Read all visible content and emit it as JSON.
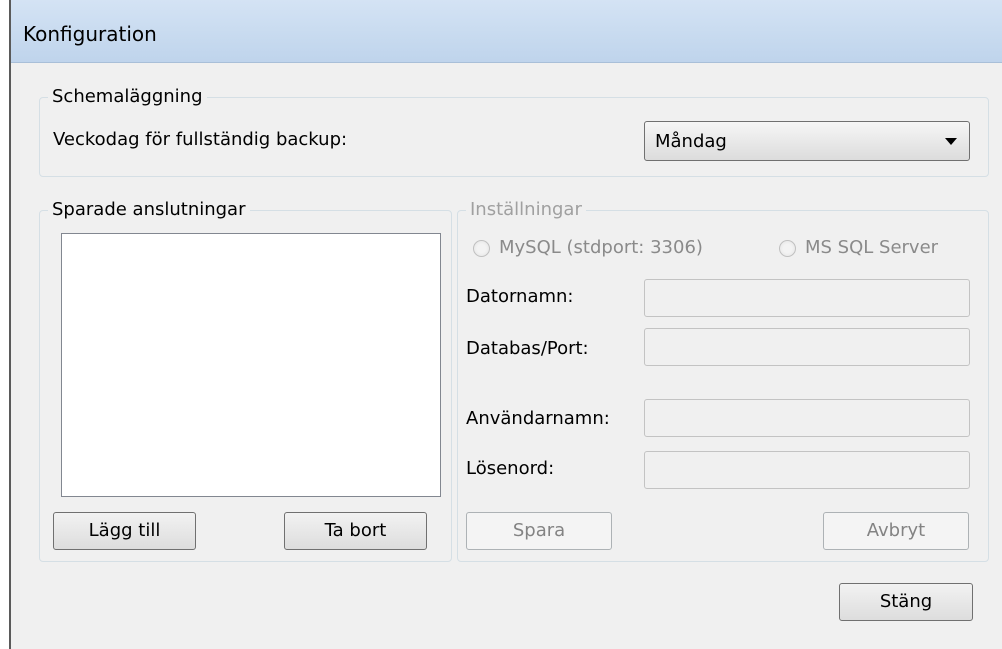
{
  "window": {
    "title": "Konfiguration"
  },
  "schedule": {
    "legend": "Schemaläggning",
    "weekday_label": "Veckodag för fullständig backup:",
    "weekday_value": "Måndag"
  },
  "saved": {
    "legend": "Sparade anslutningar",
    "items": [],
    "add_label": "Lägg till",
    "remove_label": "Ta bort"
  },
  "settings": {
    "legend": "Inställningar",
    "radio_mysql": "MySQL (stdport: 3306)",
    "radio_mssql": "MS SQL Server",
    "computer_label": "Datornamn:",
    "computer_value": "",
    "database_label": "Databas/Port:",
    "database_value": "",
    "username_label": "Användarnamn:",
    "username_value": "",
    "password_label": "Lösenord:",
    "password_value": "",
    "save_label": "Spara",
    "cancel_label": "Avbryt"
  },
  "footer": {
    "close_label": "Stäng"
  }
}
